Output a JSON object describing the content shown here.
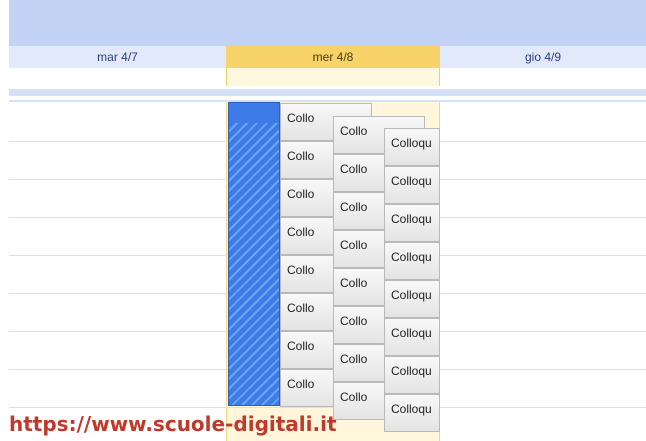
{
  "columns": [
    {
      "label": "mar 4/7"
    },
    {
      "label": "mer 4/8"
    },
    {
      "label": "gio 4/9"
    }
  ],
  "events": {
    "col1": [
      "Collo",
      "Collo",
      "Collo",
      "Collo",
      "Collo",
      "Collo",
      "Collo",
      "Collo"
    ],
    "col2": [
      "Collo",
      "Collo",
      "Collo",
      "Collo",
      "Collo",
      "Collo",
      "Collo",
      "Collo"
    ],
    "col3": [
      "Colloqu",
      "Colloqu",
      "Colloqu",
      "Colloqu",
      "Colloqu",
      "Colloqu",
      "Colloqu",
      "Colloqu"
    ]
  },
  "watermark": "https://www.scuole-digitali.it",
  "colors": {
    "header_band": "#c3d3f5",
    "today_header": "#f7d36a",
    "selection_block": "#3d7ce6",
    "watermark": "#c0392b"
  }
}
